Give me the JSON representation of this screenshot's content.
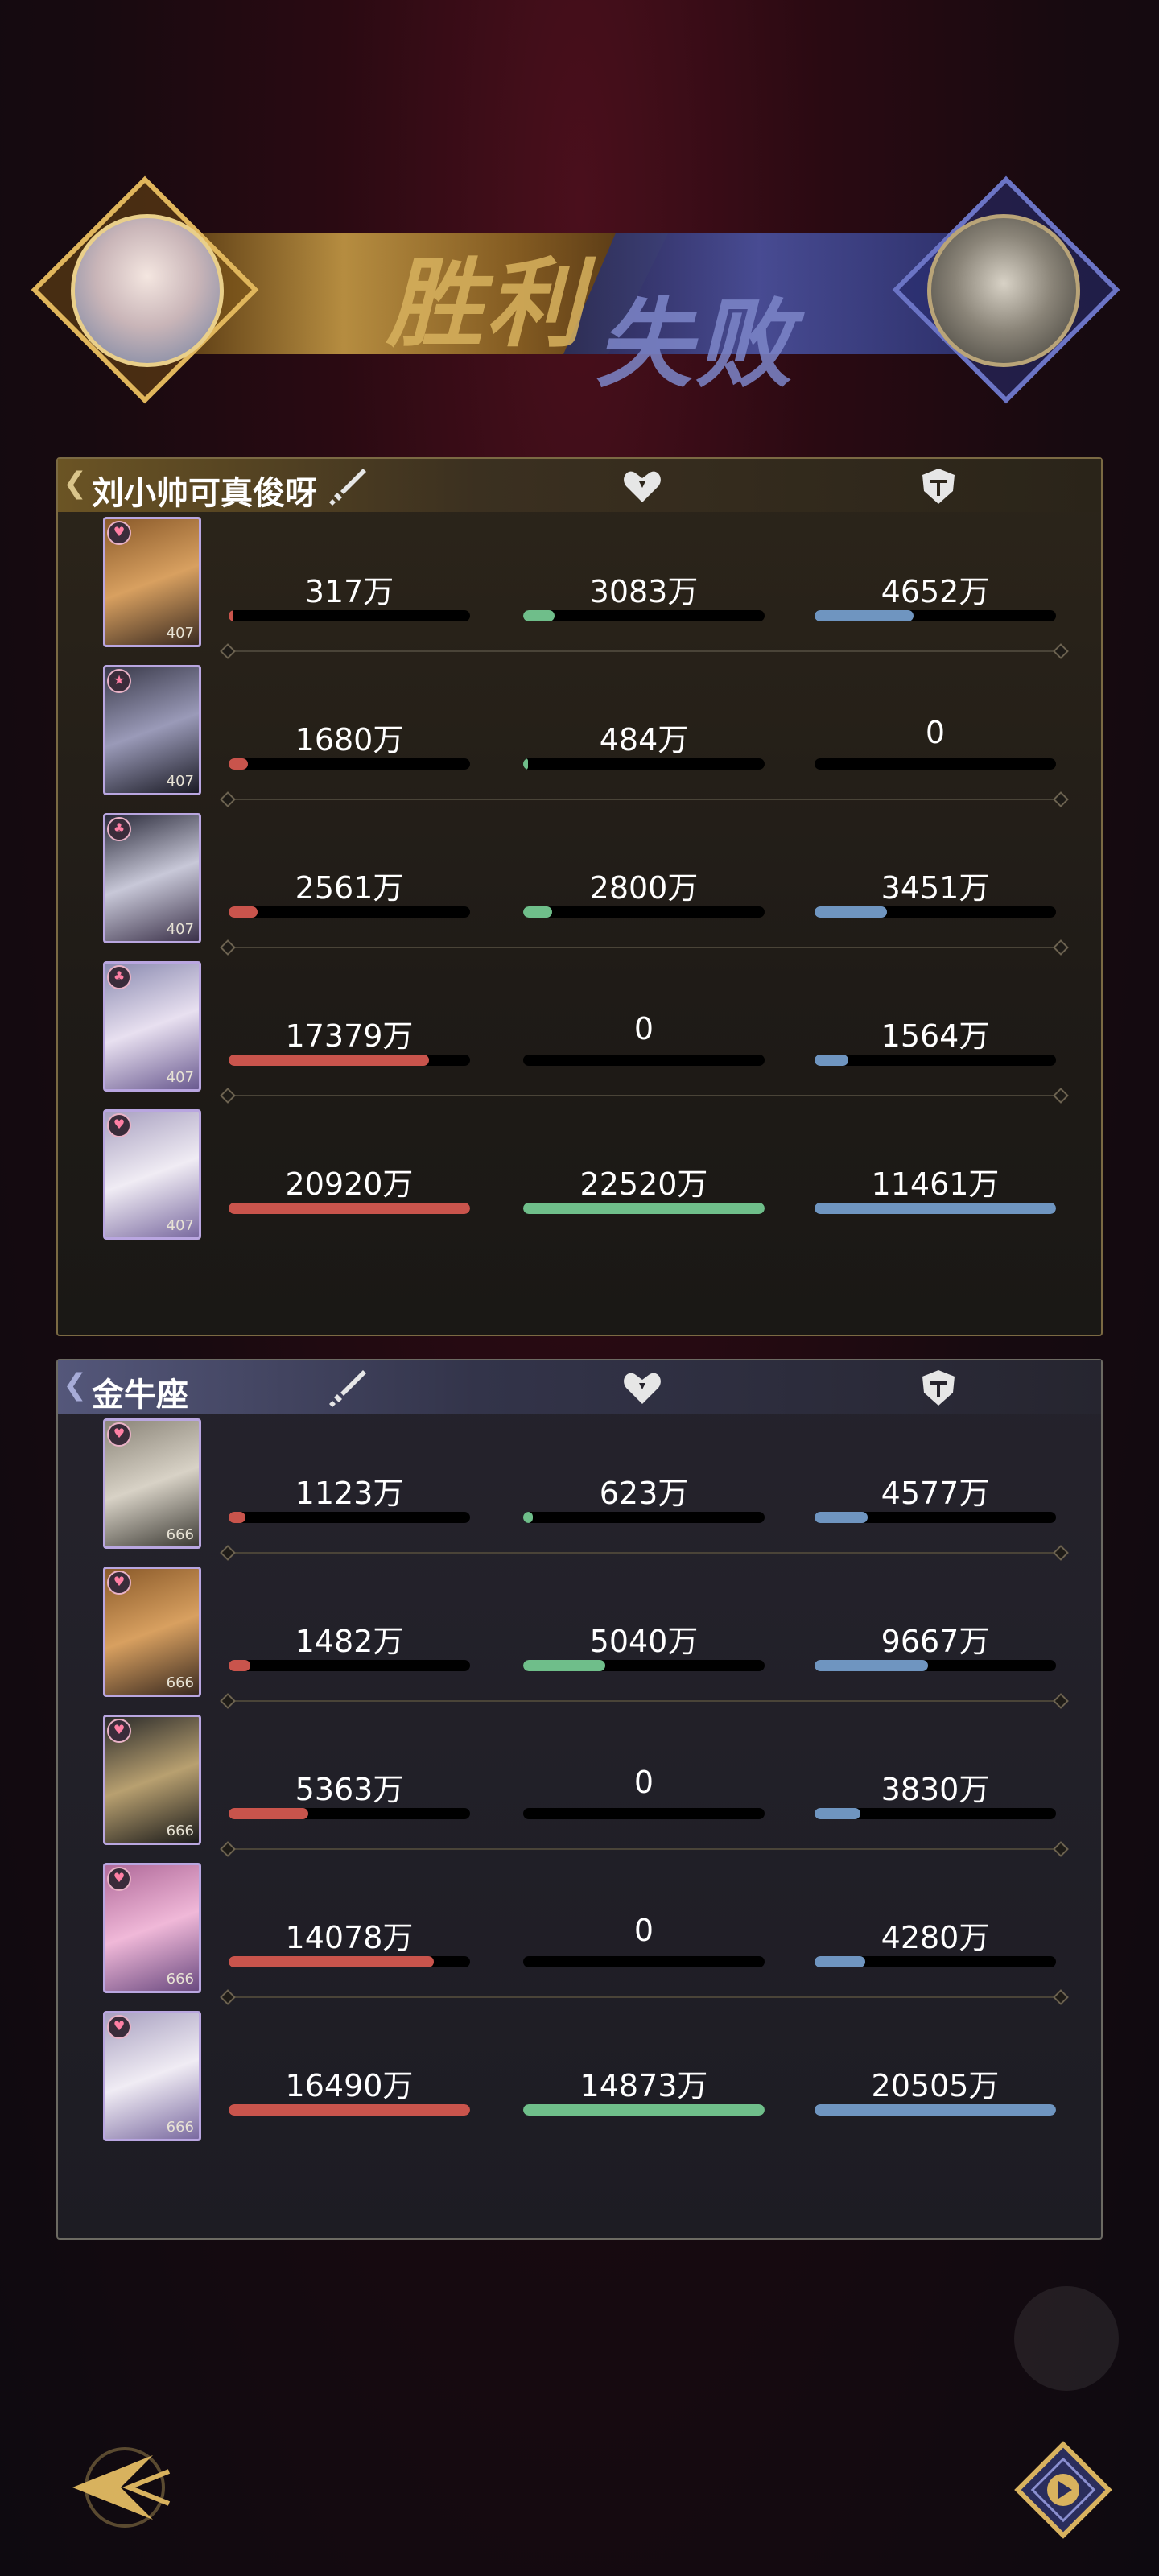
{
  "banner": {
    "win_label": "胜利",
    "lose_label": "失败"
  },
  "teams": [
    {
      "name": "刘小帅可真俊呀",
      "rows": [
        {
          "dmg": "317万",
          "dmg_f": 0.01,
          "heal": "3083万",
          "heal_f": 0.13,
          "tank": "4652万",
          "tank_f": 0.41,
          "lvl": "407",
          "badge": "heart"
        },
        {
          "dmg": "1680万",
          "dmg_f": 0.08,
          "heal": "484万",
          "heal_f": 0.02,
          "tank": "0",
          "tank_f": 0,
          "lvl": "407",
          "badge": "star"
        },
        {
          "dmg": "2561万",
          "dmg_f": 0.12,
          "heal": "2800万",
          "heal_f": 0.12,
          "tank": "3451万",
          "tank_f": 0.3,
          "lvl": "407",
          "badge": "club"
        },
        {
          "dmg": "17379万",
          "dmg_f": 0.83,
          "heal": "0",
          "heal_f": 0,
          "tank": "1564万",
          "tank_f": 0.14,
          "lvl": "407",
          "badge": "club"
        },
        {
          "dmg": "20920万",
          "dmg_f": 1.0,
          "heal": "22520万",
          "heal_f": 1.0,
          "tank": "11461万",
          "tank_f": 1.0,
          "lvl": "407",
          "badge": "heart"
        }
      ]
    },
    {
      "name": "金牛座",
      "rows": [
        {
          "dmg": "1123万",
          "dmg_f": 0.07,
          "heal": "623万",
          "heal_f": 0.04,
          "tank": "4577万",
          "tank_f": 0.22,
          "lvl": "666",
          "badge": "heart"
        },
        {
          "dmg": "1482万",
          "dmg_f": 0.09,
          "heal": "5040万",
          "heal_f": 0.34,
          "tank": "9667万",
          "tank_f": 0.47,
          "lvl": "666",
          "badge": "heart"
        },
        {
          "dmg": "5363万",
          "dmg_f": 0.33,
          "heal": "0",
          "heal_f": 0,
          "tank": "3830万",
          "tank_f": 0.19,
          "lvl": "666",
          "badge": "heart"
        },
        {
          "dmg": "14078万",
          "dmg_f": 0.85,
          "heal": "0",
          "heal_f": 0,
          "tank": "4280万",
          "tank_f": 0.21,
          "lvl": "666",
          "badge": "heart"
        },
        {
          "dmg": "16490万",
          "dmg_f": 1.0,
          "heal": "14873万",
          "heal_f": 1.0,
          "tank": "20505万",
          "tank_f": 1.0,
          "lvl": "666",
          "badge": "heart"
        }
      ]
    }
  ],
  "icons": {
    "damage": "sword-icon",
    "heal": "heart-icon",
    "tank": "shield-icon",
    "back": "back-arrow-icon",
    "replay": "replay-icon"
  },
  "colors": {
    "damage_bar": "#c9544c",
    "heal_bar": "#6fbe8a",
    "tank_bar": "#6f95c0",
    "win_gold": "#d8b25e",
    "lose_blue": "#6b74c5"
  }
}
